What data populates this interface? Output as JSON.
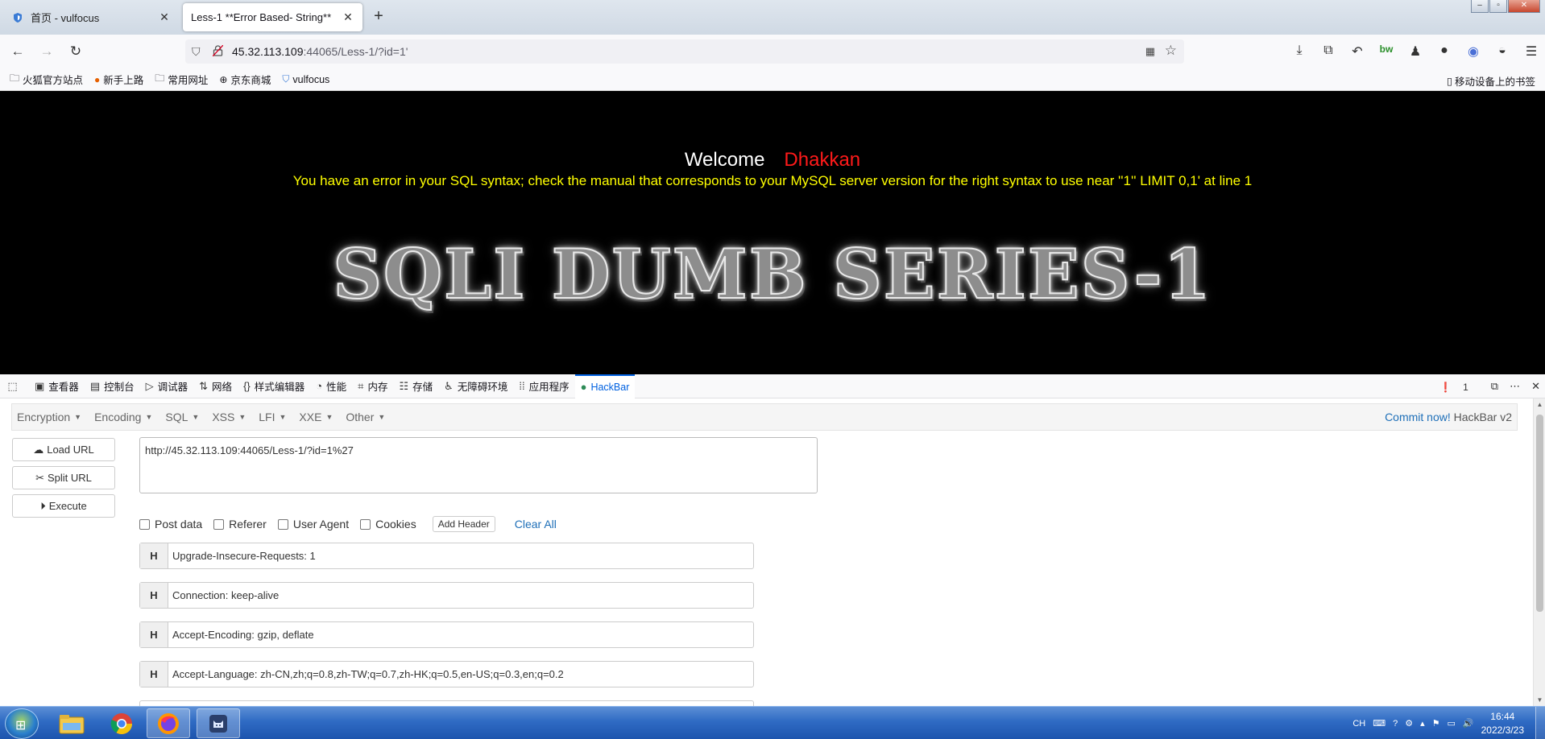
{
  "browser": {
    "tabs": [
      {
        "title": "首页 - vulfocus",
        "active": false
      },
      {
        "title": "Less-1 **Error Based- String**",
        "active": true
      }
    ],
    "url": {
      "host": "45.32.113.109",
      "rest": ":44065/Less-1/?id=1'"
    },
    "bookmarks": [
      "火狐官方站点",
      "新手上路",
      "常用网址",
      "京东商城",
      "vulfocus"
    ],
    "mobile_bookmarks": "移动设备上的书签"
  },
  "page": {
    "welcome": "Welcome",
    "name": "Dhakkan",
    "error": "You have an error in your SQL syntax; check the manual that corresponds to your MySQL server version for the right syntax to use near ''1'' LIMIT 0,1' at line 1",
    "banner": "SQLI DUMB SERIES-1"
  },
  "devtools": {
    "tabs": [
      "查看器",
      "控制台",
      "调试器",
      "网络",
      "样式编辑器",
      "性能",
      "内存",
      "存储",
      "无障碍环境",
      "应用程序",
      "HackBar"
    ],
    "error_count": "1"
  },
  "hackbar": {
    "menu": [
      "Encryption",
      "Encoding",
      "SQL",
      "XSS",
      "LFI",
      "XXE",
      "Other"
    ],
    "commit_link": "Commit now!",
    "commit_version": "HackBar v2",
    "buttons": {
      "load": "Load URL",
      "split": "Split URL",
      "execute": "Execute"
    },
    "url_value": "http://45.32.113.109:44065/Less-1/?id=1%27",
    "options": [
      "Post data",
      "Referer",
      "User Agent",
      "Cookies"
    ],
    "add_header": "Add Header",
    "clear_all": "Clear All",
    "header_label": "H",
    "headers": [
      "Upgrade-Insecure-Requests: 1",
      "Connection: keep-alive",
      "Accept-Encoding: gzip, deflate",
      "Accept-Language: zh-CN,zh;q=0.8,zh-TW;q=0.7,zh-HK;q=0.5,en-US;q=0.3,en;q=0.2"
    ]
  },
  "taskbar": {
    "time": "16:44",
    "date": "2022/3/23",
    "ime": "CH"
  },
  "colors": {
    "welcome_name": "#ff1a1a",
    "sql_error": "#ffff00",
    "devtools_active": "#0061e0",
    "link": "#1e6fb8"
  }
}
